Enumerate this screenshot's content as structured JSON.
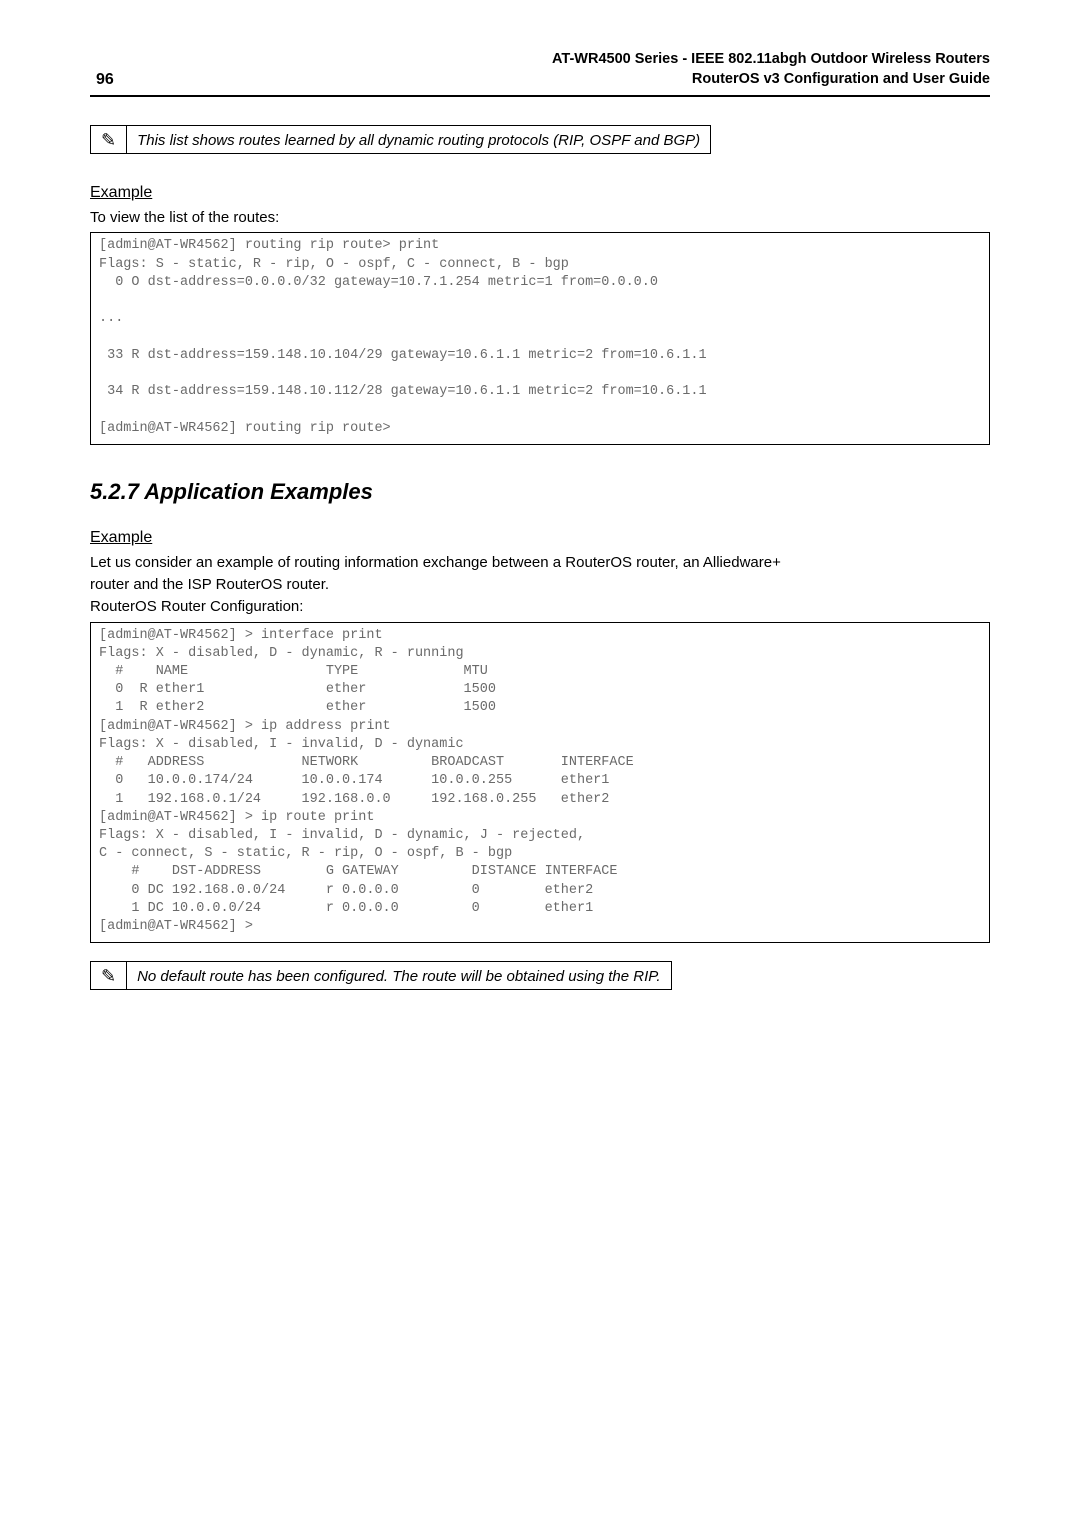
{
  "header": {
    "page_number": "96",
    "title_line1": "AT-WR4500 Series - IEEE 802.11abgh Outdoor Wireless Routers",
    "title_line2": "RouterOS v3 Configuration and User Guide"
  },
  "note1": {
    "icon": "✎",
    "text": "This list shows routes learned by all dynamic routing protocols (RIP, OSPF and BGP)"
  },
  "example1": {
    "heading": "Example",
    "intro": "To view the list of the routes:",
    "code": "[admin@AT-WR4562] routing rip route> print\nFlags: S - static, R - rip, O - ospf, C - connect, B - bgp\n  0 O dst-address=0.0.0.0/32 gateway=10.7.1.254 metric=1 from=0.0.0.0\n\n...\n\n 33 R dst-address=159.148.10.104/29 gateway=10.6.1.1 metric=2 from=10.6.1.1\n\n 34 R dst-address=159.148.10.112/28 gateway=10.6.1.1 metric=2 from=10.6.1.1\n\n[admin@AT-WR4562] routing rip route>"
  },
  "appex": {
    "heading": "5.2.7 Application Examples",
    "sub_heading": "Example",
    "intro_line1": "Let us consider an example of routing information exchange between a RouterOS router, an Alliedware+",
    "intro_line2": "router and the ISP RouterOS router.",
    "intro_line3": "RouterOS Router Configuration:",
    "code": "[admin@AT-WR4562] > interface print\nFlags: X - disabled, D - dynamic, R - running\n  #    NAME                 TYPE             MTU\n  0  R ether1               ether            1500\n  1  R ether2               ether            1500\n[admin@AT-WR4562] > ip address print\nFlags: X - disabled, I - invalid, D - dynamic\n  #   ADDRESS            NETWORK         BROADCAST       INTERFACE\n  0   10.0.0.174/24      10.0.0.174      10.0.0.255      ether1\n  1   192.168.0.1/24     192.168.0.0     192.168.0.255   ether2\n[admin@AT-WR4562] > ip route print\nFlags: X - disabled, I - invalid, D - dynamic, J - rejected,\nC - connect, S - static, R - rip, O - ospf, B - bgp\n    #    DST-ADDRESS        G GATEWAY         DISTANCE INTERFACE\n    0 DC 192.168.0.0/24     r 0.0.0.0         0        ether2\n    1 DC 10.0.0.0/24        r 0.0.0.0         0        ether1\n[admin@AT-WR4562] >"
  },
  "note2": {
    "icon": "✎",
    "text": "No default route has been configured. The route will be obtained using the RIP."
  }
}
